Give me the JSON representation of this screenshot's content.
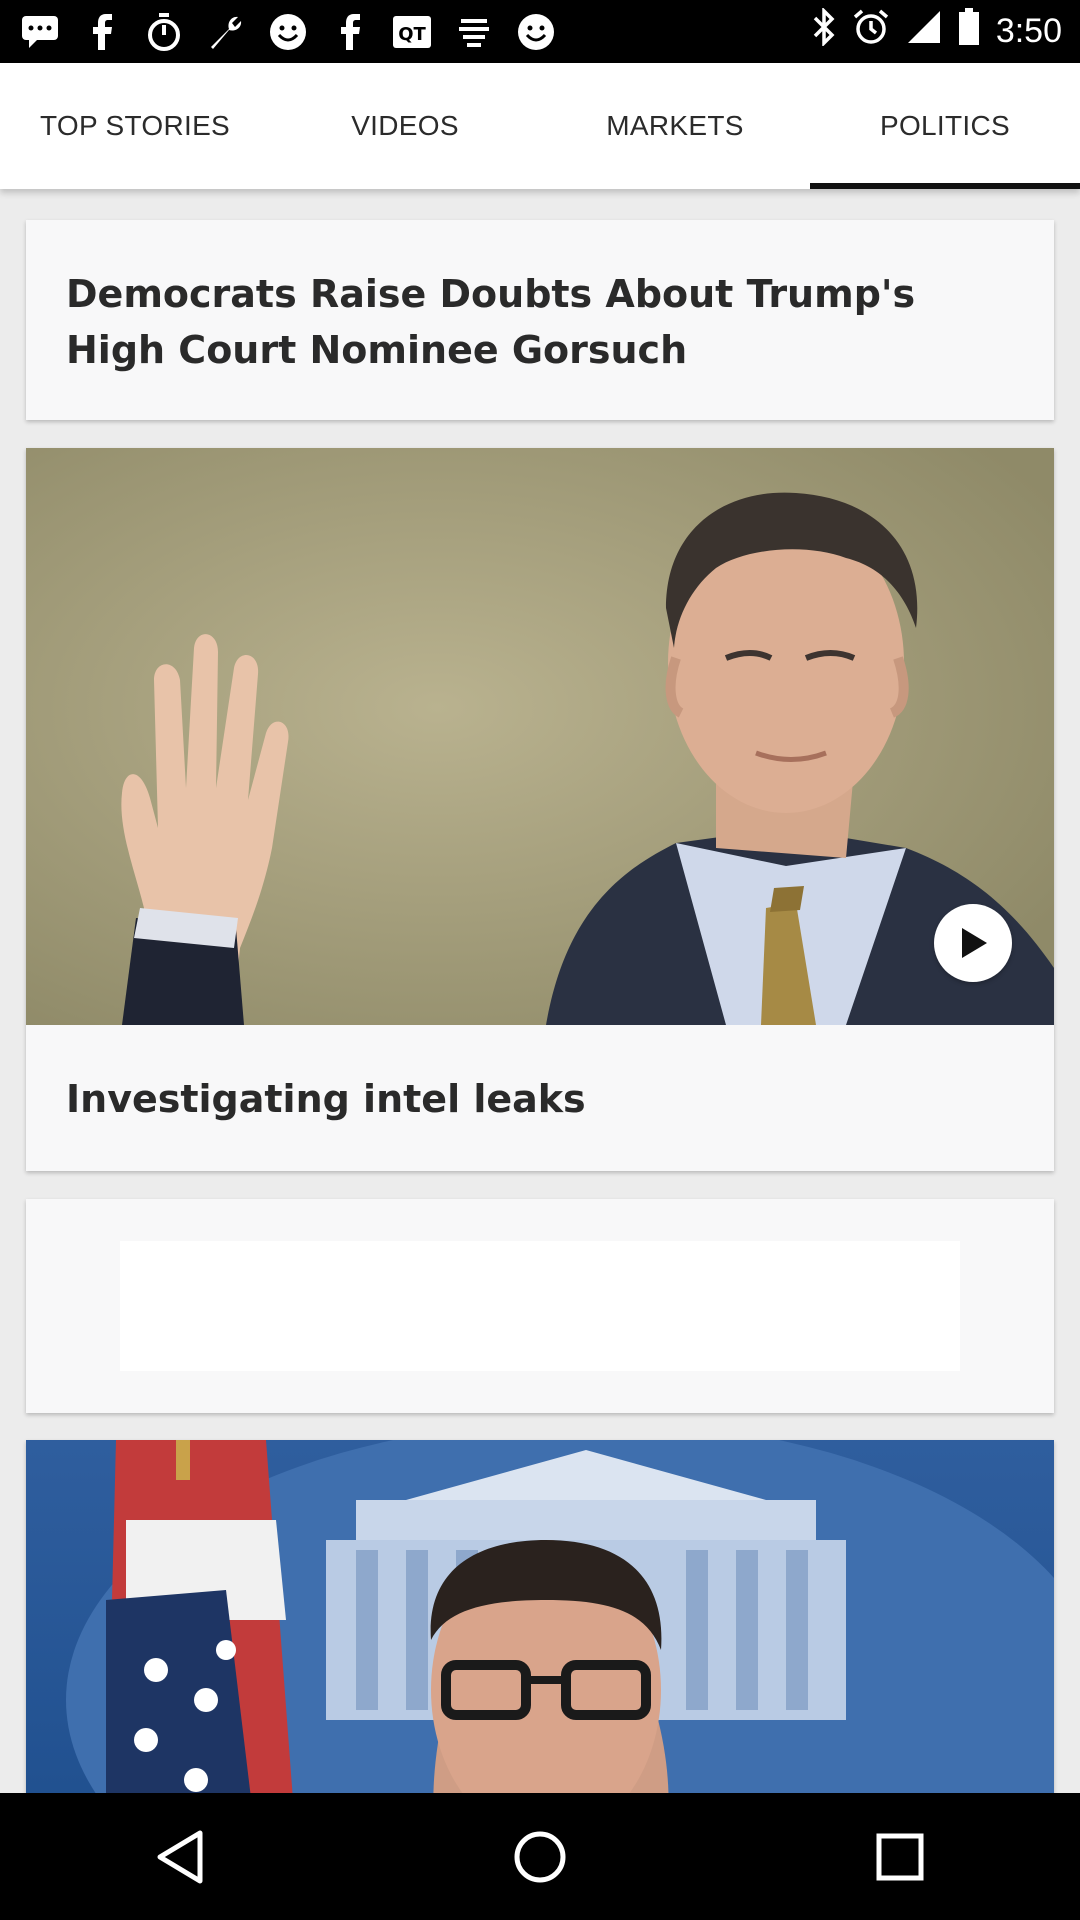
{
  "status_bar": {
    "time": "3:50",
    "left_icons": [
      "chat-icon",
      "facebook-icon",
      "timer-icon",
      "wrench-icon",
      "smiley-icon",
      "facebook-icon",
      "qt-icon",
      "app-icon",
      "smiley-icon"
    ],
    "right_icons": [
      "bluetooth-icon",
      "alarm-icon",
      "signal-icon",
      "battery-icon"
    ]
  },
  "tabs": [
    {
      "label": "TOP STORIES",
      "active": false
    },
    {
      "label": "VIDEOS",
      "active": false
    },
    {
      "label": "MARKETS",
      "active": false
    },
    {
      "label": "POLITICS",
      "active": true
    }
  ],
  "feed": {
    "article1": {
      "title": "Democrats Raise Doubts About Trump's High Court Nominee Gorsuch"
    },
    "article2": {
      "title": "Investigating intel leaks",
      "has_video": true
    },
    "article3": {
      "placeholder": true
    },
    "article4": {
      "image": "white-house-briefing-photo"
    }
  },
  "nav": [
    "back-icon",
    "home-icon",
    "recents-icon"
  ],
  "colors": {
    "tab_indicator": "#111111",
    "card_bg": "#f8f8f9",
    "page_bg": "#ececec"
  }
}
